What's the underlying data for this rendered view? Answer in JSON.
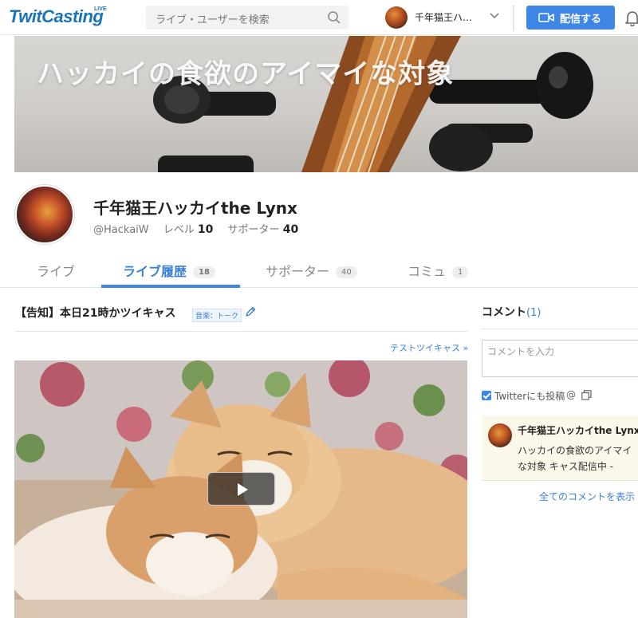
{
  "header": {
    "logo": "TwitCasting",
    "logo_badge": "LIVE",
    "search_placeholder": "ライブ・ユーザーを検索",
    "user_name": "千年猫王ハ…",
    "broadcast_label": "配信する"
  },
  "banner": {
    "title": "ハッカイの食欲のアイマイな対象"
  },
  "profile": {
    "name": "千年猫王ハッカイthe Lynx",
    "handle": "@HackaiW",
    "level_label": "レベル",
    "level": "10",
    "supporter_label": "サポーター",
    "supporters": "40"
  },
  "tabs": [
    {
      "label": "ライブ",
      "count": ""
    },
    {
      "label": "ライブ履歴",
      "count": "18"
    },
    {
      "label": "サポーター",
      "count": "40"
    },
    {
      "label": "コミュ",
      "count": "1"
    }
  ],
  "live": {
    "title": "【告知】本日21時かツイキャス",
    "genre": "音楽：トーク",
    "test_link": "テストツイキャス »"
  },
  "comments": {
    "heading": "コメント",
    "count": "(1)",
    "input_placeholder": "コメントを入力",
    "twitter_label": "Twitterにも投稿",
    "at_symbol": "@",
    "items": [
      {
        "user": "千年猫王ハッカイthe Lynx",
        "text": "ハッカイの食欲のアイマイな対象 キャス配信中 -"
      }
    ],
    "all_link": "全てのコメントを表示"
  },
  "colors": {
    "brand": "#1b73b8",
    "accent": "#3e86e6",
    "comment_bg": "#fbf8ea"
  }
}
